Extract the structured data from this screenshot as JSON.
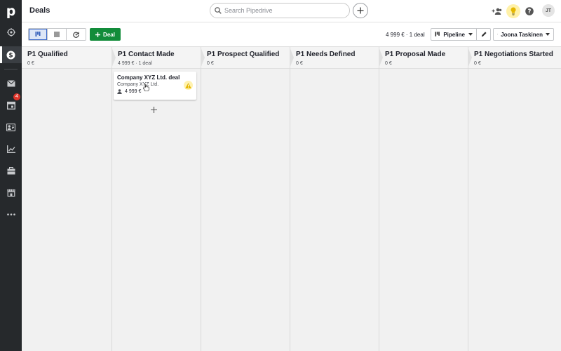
{
  "sidebar": {
    "logo": "p",
    "items": [
      {
        "icon": "target-icon",
        "name": "sidebar-item-leads"
      },
      {
        "icon": "dollar-icon",
        "name": "sidebar-item-deals",
        "active": true
      },
      {
        "icon": "mail-icon",
        "name": "sidebar-item-mail"
      },
      {
        "icon": "calendar-icon",
        "name": "sidebar-item-activities",
        "badge": "4"
      },
      {
        "icon": "contacts-icon",
        "name": "sidebar-item-contacts"
      },
      {
        "icon": "chart-icon",
        "name": "sidebar-item-insights"
      },
      {
        "icon": "box-icon",
        "name": "sidebar-item-products"
      },
      {
        "icon": "store-icon",
        "name": "sidebar-item-marketplace"
      },
      {
        "icon": "more-icon",
        "name": "sidebar-item-more"
      }
    ]
  },
  "header": {
    "title": "Deals",
    "search_placeholder": "Search Pipedrive",
    "avatar_initials": "JT"
  },
  "toolbar": {
    "deal_label": "Deal",
    "summary": "4 999 € · 1 deal",
    "pipeline_label": "Pipeline",
    "user_filter_label": "Joona Taskinen"
  },
  "stages": [
    {
      "title": "P1 Qualified",
      "summary": "0 €"
    },
    {
      "title": "P1 Contact Made",
      "summary": "4 999 € · 1 deal"
    },
    {
      "title": "P1 Prospect Qualified",
      "summary": "0 €"
    },
    {
      "title": "P1 Needs Defined",
      "summary": "0 €"
    },
    {
      "title": "P1 Proposal Made",
      "summary": "0 €"
    },
    {
      "title": "P1 Negotiations Started",
      "summary": "0 €"
    }
  ],
  "deal_card": {
    "title": "Company XYZ Ltd. deal",
    "organization": "Company XYZ Ltd.",
    "value": "4 999 €"
  },
  "colors": {
    "sidebar_bg": "#26292c",
    "primary_green": "#128c3a",
    "active_view": "#3867c9",
    "badge_red": "#e0352b",
    "warning_yellow": "#fff2b0"
  }
}
